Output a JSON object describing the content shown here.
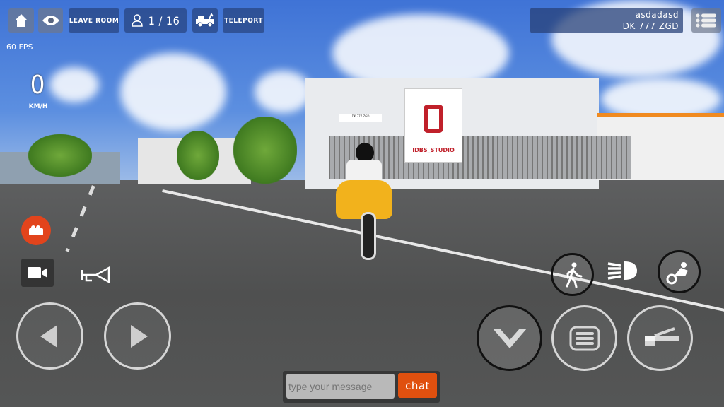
{
  "hud": {
    "leave_room": "LEAVE ROOM",
    "players": "1 / 16",
    "teleport": "TELEPORT",
    "fps": "60 FPS",
    "speed": "0",
    "speed_unit": "KM/H"
  },
  "player": {
    "name": "asdadasd",
    "plate": "DK 777 ZGD"
  },
  "scene": {
    "billboard": "IDBS_STUDIO",
    "building_sign": "DK 777 ZGD"
  },
  "chat": {
    "placeholder": "type your message",
    "button": "chat"
  },
  "colors": {
    "accent": "#e0500f",
    "hud_button": "#2c4a86"
  }
}
